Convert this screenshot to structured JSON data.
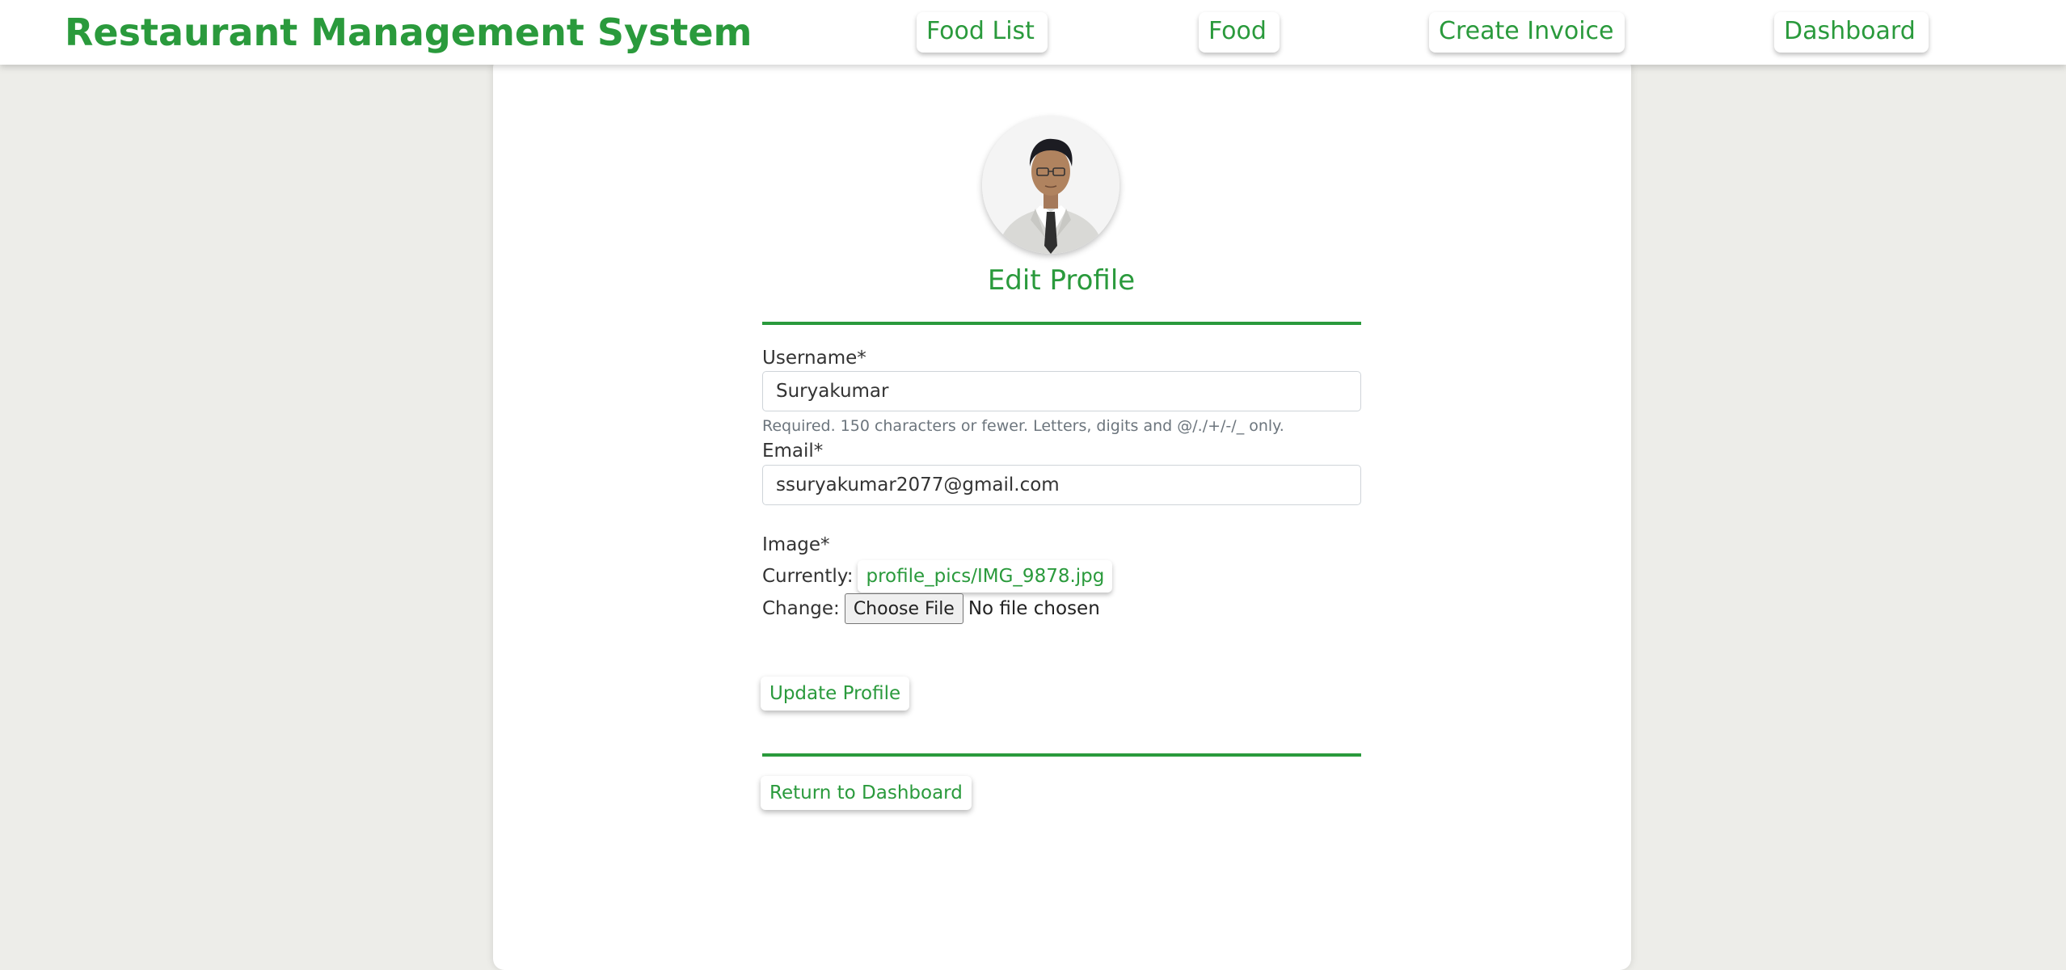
{
  "navbar": {
    "brand": "Restaurant Management System",
    "links": [
      {
        "label": "Food List"
      },
      {
        "label": "Food"
      },
      {
        "label": "Create Invoice"
      },
      {
        "label": "Dashboard"
      }
    ]
  },
  "profile": {
    "title": "Edit Profile",
    "avatar_icon": "profile-photo",
    "form": {
      "username": {
        "label": "Username*",
        "value": "Suryakumar",
        "help": "Required. 150 characters or fewer. Letters, digits and @/./+/-/_ only."
      },
      "email": {
        "label": "Email*",
        "value": "ssuryakumar2077@gmail.com"
      },
      "image": {
        "label": "Image*",
        "currently_label": "Currently:",
        "current_file": "profile_pics/IMG_9878.jpg",
        "change_label": "Change:",
        "choose_button": "Choose File",
        "file_status": "No file chosen"
      },
      "submit_label": "Update Profile"
    },
    "return_label": "Return to Dashboard"
  },
  "colors": {
    "accent": "#2a9a3c",
    "background": "#edede9",
    "card": "#ffffff"
  }
}
